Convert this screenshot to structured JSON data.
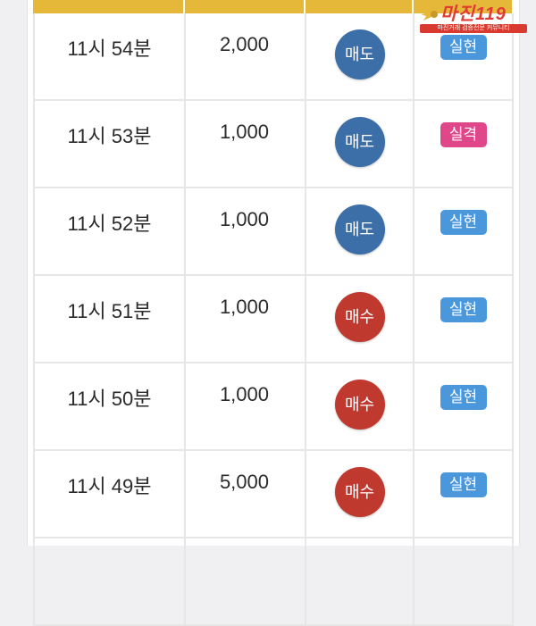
{
  "colors": {
    "header": "#e6b83a",
    "sell": "#3c6fa8",
    "buy": "#c0392f",
    "badge_success": "#4a97dc",
    "badge_fail": "#e0468a"
  },
  "logo": {
    "title": "마진119",
    "subtitle": "마진거래 검증전문 커뮤니티"
  },
  "rows": [
    {
      "time": "11시 54분",
      "amount": "2,000",
      "side": "매도",
      "side_type": "sell",
      "result": "실현",
      "result_type": "success"
    },
    {
      "time": "11시 53분",
      "amount": "1,000",
      "side": "매도",
      "side_type": "sell",
      "result": "실격",
      "result_type": "fail"
    },
    {
      "time": "11시 52분",
      "amount": "1,000",
      "side": "매도",
      "side_type": "sell",
      "result": "실현",
      "result_type": "success"
    },
    {
      "time": "11시 51분",
      "amount": "1,000",
      "side": "매수",
      "side_type": "buy",
      "result": "실현",
      "result_type": "success"
    },
    {
      "time": "11시 50분",
      "amount": "1,000",
      "side": "매수",
      "side_type": "buy",
      "result": "실현",
      "result_type": "success"
    },
    {
      "time": "11시 49분",
      "amount": "5,000",
      "side": "매수",
      "side_type": "buy",
      "result": "실현",
      "result_type": "success"
    }
  ]
}
